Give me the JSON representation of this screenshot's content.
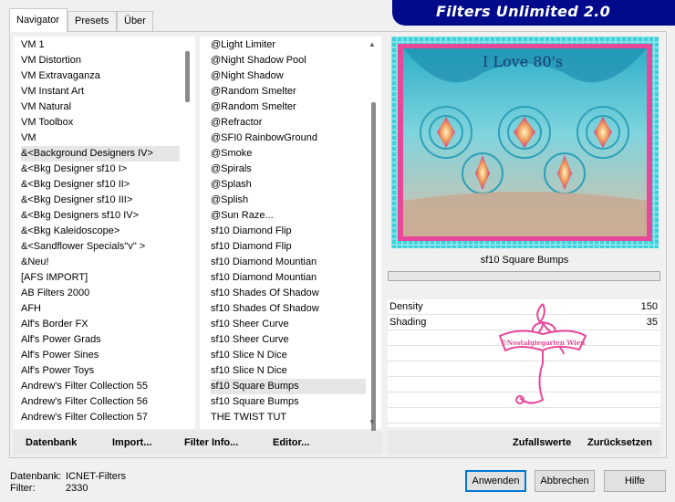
{
  "banner": {
    "title": "Filters Unlimited 2.0"
  },
  "tabs": [
    {
      "label": "Navigator"
    },
    {
      "label": "Presets"
    },
    {
      "label": "Über"
    }
  ],
  "categories": [
    "VM 1",
    "VM Distortion",
    "VM Extravaganza",
    "VM Instant Art",
    "VM Natural",
    "VM Toolbox",
    "VM",
    "&<Background Designers IV>",
    "&<Bkg Designer sf10 I>",
    "&<Bkg Designer sf10 II>",
    "&<Bkg Designer sf10 III>",
    "&<Bkg Designers sf10 IV>",
    "&<Bkg Kaleidoscope>",
    "&<Sandflower Specials\"v\" >",
    "&Neu!",
    "[AFS IMPORT]",
    "AB Filters 2000",
    "AFH",
    "Alf's Border FX",
    "Alf's Power Grads",
    "Alf's Power Sines",
    "Alf's Power Toys",
    "Andrew's Filter Collection 55",
    "Andrew's Filter Collection 56",
    "Andrew's Filter Collection 57"
  ],
  "filters": [
    "@Light Limiter",
    "@Night Shadow Pool",
    "@Night Shadow",
    "@Random Smelter",
    "@Random Smelter",
    "@Refractor",
    "@SFI0 RainbowGround",
    "@Smoke",
    "@Spirals",
    "@Splash",
    "@Splish",
    "@Sun Raze...",
    "sf10 Diamond Flip",
    "sf10 Diamond Flip",
    "sf10 Diamond Mountian",
    "sf10 Diamond Mountian",
    "sf10 Shades Of Shadow",
    "sf10 Shades Of Shadow",
    "sf10 Sheer Curve",
    "sf10 Sheer Curve",
    "sf10 Slice N Dice",
    "sf10 Slice N Dice",
    "sf10 Square Bumps",
    "sf10 Square Bumps",
    "THE TWIST TUT"
  ],
  "selected_category_index": 7,
  "selected_filter_index": 22,
  "preview": {
    "filter_name": "sf10 Square Bumps",
    "overlay_text": "I Love 80's",
    "watermark": "©Nostalgiegarten Wien"
  },
  "parameters": [
    {
      "label": "Density",
      "value": "150"
    },
    {
      "label": "Shading",
      "value": "35"
    }
  ],
  "left_actions": {
    "datenbank": "Datenbank",
    "import": "Import...",
    "filter_info": "Filter Info...",
    "editor": "Editor..."
  },
  "right_actions": {
    "zufallswerte": "Zufallswerte",
    "zuruecksetzen": "Zurücksetzen"
  },
  "status": {
    "db_label": "Datenbank:",
    "db_value": "ICNET-Filters",
    "filter_label": "Filter:",
    "filter_value": "2330"
  },
  "buttons": {
    "apply": "Anwenden",
    "cancel": "Abbrechen",
    "help": "Hilfe"
  },
  "colors": {
    "banner": "#000a8a",
    "accent": "#0078d7",
    "preview_frame": "#e83a8e"
  }
}
